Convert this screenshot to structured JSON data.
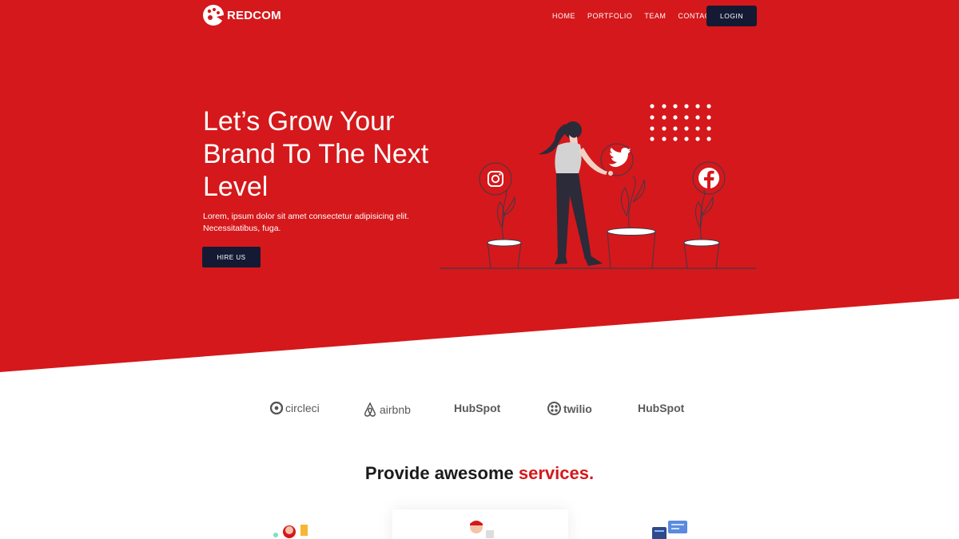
{
  "brand": {
    "name": "REDCOM",
    "accent": "#d5181b",
    "dark": "#141a33"
  },
  "nav": {
    "items": [
      "HOME",
      "PORTFOLIO",
      "TEAM",
      "CONTACT"
    ],
    "login_label": "LOGIN"
  },
  "hero": {
    "title": "Let’s Grow Your Brand To The Next Level",
    "subtitle": "Lorem, ipsum dolor sit amet consectetur adipisicing elit. Necessitatibus, fuga.",
    "cta_label": "HIRE US",
    "illustration_icons": [
      "instagram-icon",
      "twitter-icon",
      "facebook-icon"
    ]
  },
  "partners": [
    {
      "name": "circleci",
      "icon": "circleci-icon"
    },
    {
      "name": "airbnb",
      "icon": "airbnb-icon"
    },
    {
      "name": "HubSpot",
      "icon": "hubspot-icon"
    },
    {
      "name": "twilio",
      "icon": "twilio-icon"
    },
    {
      "name": "HubSpot",
      "icon": "hubspot-icon"
    }
  ],
  "services": {
    "title_main": "Provide awesome",
    "title_accent": "services."
  }
}
